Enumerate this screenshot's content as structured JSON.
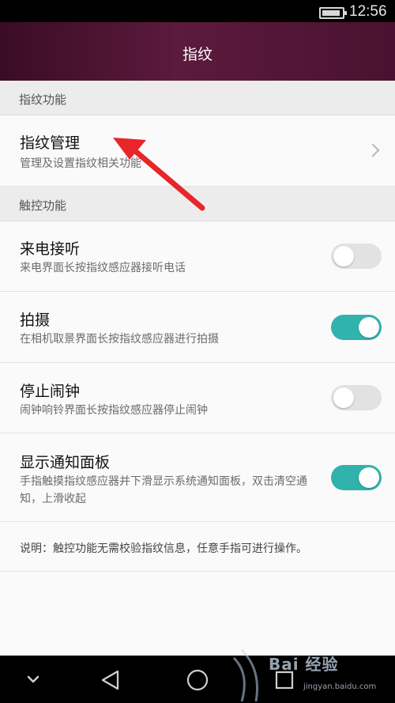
{
  "status_bar": {
    "time": "12:56",
    "battery_level": 0.75
  },
  "header": {
    "title": "指纹"
  },
  "sections": [
    {
      "title": "指纹功能"
    },
    {
      "title": "触控功能"
    }
  ],
  "fingerprint_management": {
    "title": "指纹管理",
    "subtitle": "管理及设置指纹相关功能"
  },
  "toggles": [
    {
      "title": "来电接听",
      "subtitle": "来电界面长按指纹感应器接听电话",
      "on": false
    },
    {
      "title": "拍摄",
      "subtitle": "在相机取景界面长按指纹感应器进行拍摄",
      "on": true
    },
    {
      "title": "停止闹钟",
      "subtitle": "闹钟响铃界面长按指纹感应器停止闹钟",
      "on": false
    },
    {
      "title": "显示通知面板",
      "subtitle": "手指触摸指纹感应器并下滑显示系统通知面板，双击清空通知，上滑收起",
      "on": true
    }
  ],
  "note": "说明：触控功能无需校验指纹信息，任意手指可进行操作。",
  "nav_bar": {
    "buttons": [
      "chevron-down-icon",
      "back-icon",
      "home-icon",
      "recents-icon"
    ]
  },
  "watermark": {
    "text": "Bai 经验",
    "url": "jingyan.baidu.com"
  },
  "colors": {
    "accent": "#2fb3ac",
    "header": "#5c1a3c",
    "arrow": "#e8262a"
  }
}
